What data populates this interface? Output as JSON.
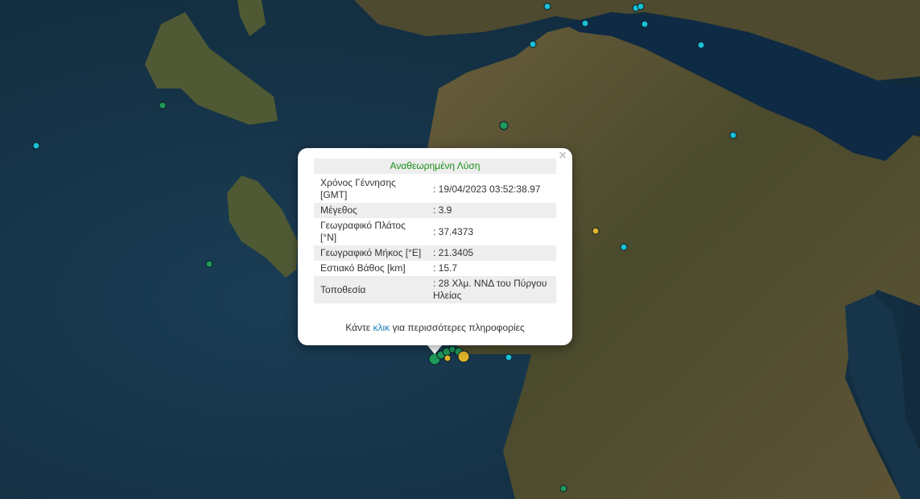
{
  "popup": {
    "title": "Αναθεωρημένη Λύση",
    "close_glyph": "×",
    "rows": [
      {
        "label": "Χρόνος Γέννησης [GMT]",
        "value": ": 19/04/2023 03:52:38.97"
      },
      {
        "label": "Μέγεθος",
        "value": ": 3.9"
      },
      {
        "label": "Γεωγραφικό Πλάτος [°N]",
        "value": ": 37.4373"
      },
      {
        "label": "Γεωγραφικό Μήκος [°E]",
        "value": ": 21.3405"
      },
      {
        "label": "Εστιακό Βάθος [km]",
        "value": ": 15.7"
      },
      {
        "label": "Τοποθεσία",
        "value": ": 28 Χλμ. ΝΝΔ του Πύργου Ηλείας"
      }
    ],
    "more_info_prefix": "Κάντε",
    "more_info_link": "κλικ",
    "more_info_suffix": "για περισσότερες πληροφορίες"
  },
  "colors": {
    "sea": "#17354a",
    "land": "#5a5234",
    "land_green": "#3d4a2a",
    "marker_cyan": "#19c0d6",
    "marker_green": "#1e9a5a",
    "marker_yellow": "#e0b52a"
  }
}
